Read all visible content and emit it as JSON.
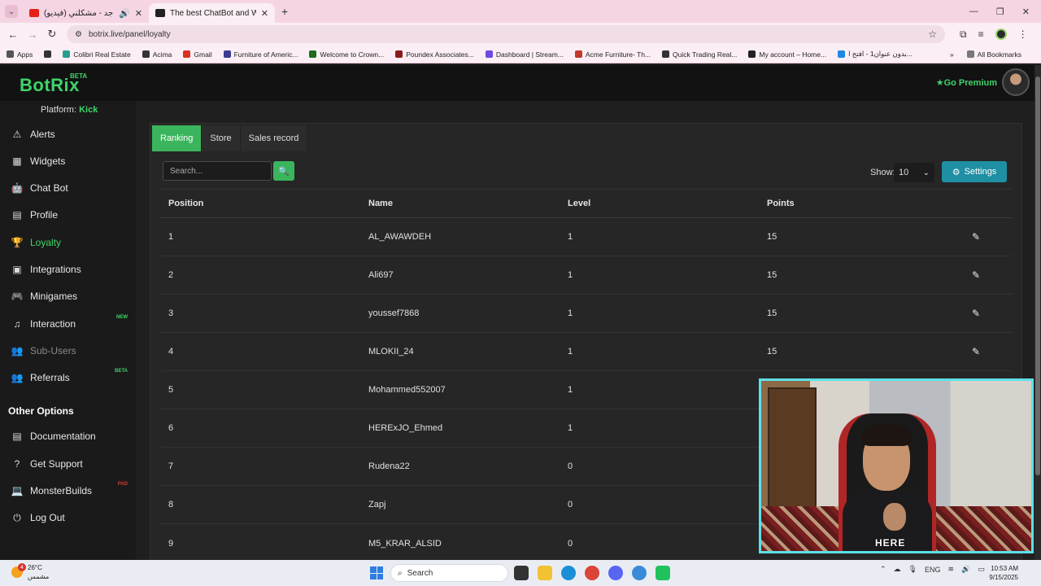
{
  "browser": {
    "tabs": [
      {
        "title": "راشد الماجد - مشكلني (فيديو)",
        "active": false,
        "favicon_color": "#e62117"
      },
      {
        "title": "The best ChatBot and Widgets",
        "active": true,
        "favicon_color": "#222222"
      }
    ],
    "url": "botrix.live/panel/loyalty",
    "bookmarks": [
      {
        "label": "Apps",
        "color": "#555555"
      },
      {
        "label": "Colibri Real Estate",
        "color": "#2a9d8f"
      },
      {
        "label": "Acima",
        "color": "#333333"
      },
      {
        "label": "Gmail",
        "color": "#d93025"
      },
      {
        "label": "Furniture of Americ...",
        "color": "#3b3b8f"
      },
      {
        "label": "Welcome to Crown...",
        "color": "#1d6b1d"
      },
      {
        "label": "Poundex Associates...",
        "color": "#8b1a1a"
      },
      {
        "label": "Dashboard | Stream...",
        "color": "#6b4ce0"
      },
      {
        "label": "Acme Furniture- Th...",
        "color": "#c0392b"
      },
      {
        "label": "Quick Trading Real...",
        "color": "#333333"
      },
      {
        "label": "My account – Home...",
        "color": "#222222"
      },
      {
        "label": "بدون عنوان1 - افتح ا...",
        "color": "#1e88e5"
      }
    ],
    "all_bookmarks": "All Bookmarks"
  },
  "header": {
    "logo": "BotRix",
    "logo_badge": "BETA",
    "premium": "Go Premium"
  },
  "sidebar": {
    "platform_label": "Platform:",
    "platform_value": "Kick",
    "items": [
      {
        "label": "Alerts",
        "icon": "⚠",
        "state": "normal",
        "tag": ""
      },
      {
        "label": "Widgets",
        "icon": "▦",
        "state": "normal",
        "tag": ""
      },
      {
        "label": "Chat Bot",
        "icon": "🤖",
        "state": "normal",
        "tag": ""
      },
      {
        "label": "Profile",
        "icon": "▤",
        "state": "normal",
        "tag": ""
      },
      {
        "label": "Loyalty",
        "icon": "🏆",
        "state": "active",
        "tag": ""
      },
      {
        "label": "Integrations",
        "icon": "▣",
        "state": "normal",
        "tag": ""
      },
      {
        "label": "Minigames",
        "icon": "🎮",
        "state": "normal",
        "tag": ""
      },
      {
        "label": "Interaction",
        "icon": "♫",
        "state": "normal",
        "tag": "NEW"
      },
      {
        "label": "Sub-Users",
        "icon": "👥",
        "state": "disabled",
        "tag": ""
      },
      {
        "label": "Referrals",
        "icon": "👥",
        "state": "normal",
        "tag": "BETA"
      }
    ],
    "other_title": "Other Options",
    "other_items": [
      {
        "label": "Documentation",
        "icon": "▤",
        "tag": ""
      },
      {
        "label": "Get Support",
        "icon": "?",
        "tag": ""
      },
      {
        "label": "MonsterBuilds",
        "icon": "💻",
        "tag": "PAD"
      },
      {
        "label": "Log Out",
        "icon": "⏻",
        "tag": ""
      }
    ]
  },
  "panel": {
    "tabs": [
      "Ranking",
      "Store",
      "Sales record"
    ],
    "search_placeholder": "Search...",
    "show_label": "Show:",
    "show_value": "10",
    "settings_label": "Settings",
    "columns": [
      "Position",
      "Name",
      "Level",
      "Points"
    ],
    "rows": [
      {
        "position": "1",
        "name": "AL_AWAWDEH",
        "level": "1",
        "points": "15"
      },
      {
        "position": "2",
        "name": "Ali697",
        "level": "1",
        "points": "15"
      },
      {
        "position": "3",
        "name": "youssef7868",
        "level": "1",
        "points": "15"
      },
      {
        "position": "4",
        "name": "MLOKII_24",
        "level": "1",
        "points": "15"
      },
      {
        "position": "5",
        "name": "Mohammed552007",
        "level": "1",
        "points": ""
      },
      {
        "position": "6",
        "name": "HERExJO_Ehmed",
        "level": "1",
        "points": ""
      },
      {
        "position": "7",
        "name": "Rudena22",
        "level": "0",
        "points": ""
      },
      {
        "position": "8",
        "name": "Zapj",
        "level": "0",
        "points": ""
      },
      {
        "position": "9",
        "name": "M5_KRAR_ALSID",
        "level": "0",
        "points": ""
      }
    ]
  },
  "webcam": {
    "logo_text": "HERE"
  },
  "taskbar": {
    "weather_temp": "26°C",
    "weather_desc": "مشمس",
    "weather_badge": "4",
    "search_label": "Search",
    "lang": "ENG",
    "time": "10:53 AM",
    "date": "9/15/2025"
  }
}
